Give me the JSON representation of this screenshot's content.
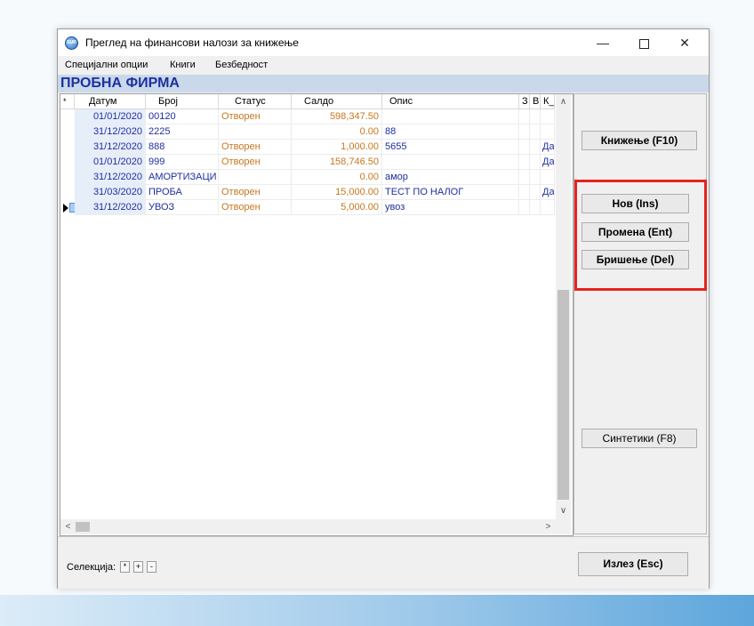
{
  "window": {
    "title": "Преглед на финансови налози за книжење",
    "icon_text": "EUR",
    "controls": {
      "minimize": "—",
      "maximize": "□",
      "close": "✕"
    }
  },
  "menu": [
    "Специјални опции",
    "Книги",
    "Безбедност"
  ],
  "company": "ПРОБНА ФИРМА",
  "grid": {
    "columns": [
      "*",
      "Датум",
      "Број",
      "Статус",
      "Салдо",
      "Опис",
      "З",
      "В",
      "К_"
    ],
    "rows": [
      {
        "date": "01/01/2020",
        "number": " 00120",
        "status": "Отворен",
        "balance": "598,347.50",
        "description": "",
        "k": ""
      },
      {
        "date": "31/12/2020",
        "number": "2225",
        "status": "",
        "balance": "0.00",
        "description": "88",
        "k": ""
      },
      {
        "date": "31/12/2020",
        "number": "888",
        "status": "Отворен",
        "balance": "1,000.00",
        "description": "5655",
        "k": "Да"
      },
      {
        "date": "01/01/2020",
        "number": "999",
        "status": "Отворен",
        "balance": "158,746.50",
        "description": "",
        "k": "Да"
      },
      {
        "date": "31/12/2020",
        "number": "АМОРТИЗАЦИ",
        "status": "",
        "balance": "0.00",
        "description": "амор",
        "k": ""
      },
      {
        "date": "31/03/2020",
        "number": "ПРОБА",
        "status": "Отворен",
        "balance": "15,000.00",
        "description": "ТЕСТ ПО НАЛОГ",
        "k": "Да"
      },
      {
        "date": "31/12/2020",
        "number": "УВОЗ",
        "status": "Отворен",
        "balance": "5,000.00",
        "description": "увоз",
        "k": ""
      }
    ],
    "current_row_index": 6
  },
  "buttons": {
    "post": "Книжење (F10)",
    "new": "Нов (Ins)",
    "edit": "Промена (Ent)",
    "delete": "Бришење (Del)",
    "synthetics": "Синтетики (F8)",
    "exit": "Излез (Esc)"
  },
  "selection": {
    "label": "Селекција:",
    "buttons": [
      "*",
      "+",
      "-"
    ]
  },
  "colors": {
    "highlight": "#e8211f",
    "company_text": "#1f2fa0",
    "status_text": "#c8771f"
  }
}
